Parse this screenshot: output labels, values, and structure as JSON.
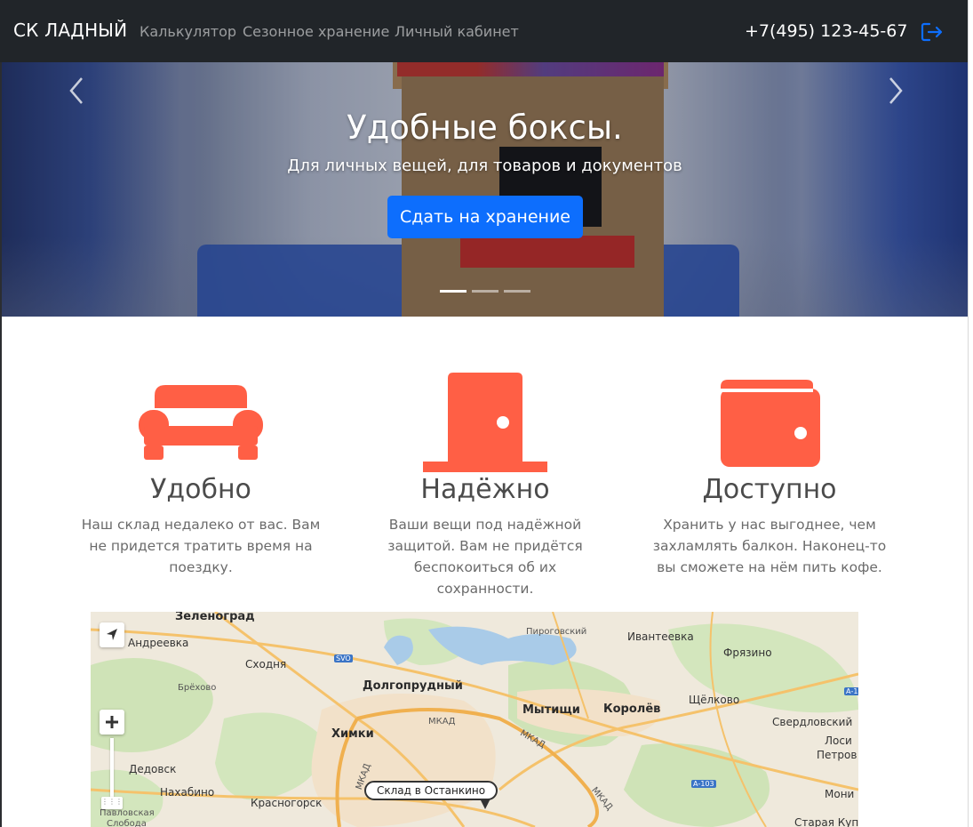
{
  "navbar": {
    "brand": "СК ЛАДНЫЙ",
    "links": [
      "Калькулятор",
      "Сезонное хранение",
      "Личный кабинет"
    ],
    "phone": "+7(495) 123-45-67",
    "logout_icon": "logout-icon"
  },
  "hero": {
    "title": "Удобные боксы.",
    "subtitle": "Для личных вещей, для товаров и документов",
    "button": "Сдать на хранение",
    "slides_count": 3,
    "active_slide": 1
  },
  "features": [
    {
      "icon": "sofa-icon",
      "title": "Удобно",
      "text": "Наш склад недалеко от вас. Вам не придется тратить время на поездку."
    },
    {
      "icon": "door-icon",
      "title": "Надёжно",
      "text": "Ваши вещи под надёжной защитой. Вам не придётся беспокоиться об их сохранности."
    },
    {
      "icon": "wallet-icon",
      "title": "Доступно",
      "text": "Хранить у нас выгоднее, чем захламлять балкон. Наконец-то вы сможете на нём пить кофе."
    }
  ],
  "map": {
    "balloon": "Склад в Останкино",
    "labels": {
      "zelenograd": "Зеленоград",
      "andreevka": "Андреевка",
      "skhodnya": "Сходня",
      "svo": "SVO",
      "brekhovo": "Брёхово",
      "dolgoprudny": "Долгопрудный",
      "pirogovsky": "Пироговский",
      "ivanteevka": "Ивантеевка",
      "fryazino": "Фрязино",
      "mytishchi": "Мытищи",
      "korolev": "Королёв",
      "shchelkovo": "Щёлково",
      "khimki": "Химки",
      "mkad1": "МКАД",
      "mkad2": "МКАД",
      "mkad3": "МКАД",
      "mkad4": "МКАД",
      "sverdlovsky": "Свердловский",
      "losino": "Лоси",
      "petrovsk": "Петров",
      "dedovsk": "Дедовск",
      "nakhabino": "Нахабино",
      "krasnogorsk": "Красногорск",
      "a103": "А-103",
      "a1": "А-1",
      "monino": "Мони",
      "staraya": "Старая Куп",
      "pavlovskaya": "Павловская",
      "sloboda": "Слобода"
    }
  },
  "colors": {
    "accent_orange": "#ff5f45",
    "primary_blue": "#0d6efd",
    "navbar_bg": "#212529"
  }
}
